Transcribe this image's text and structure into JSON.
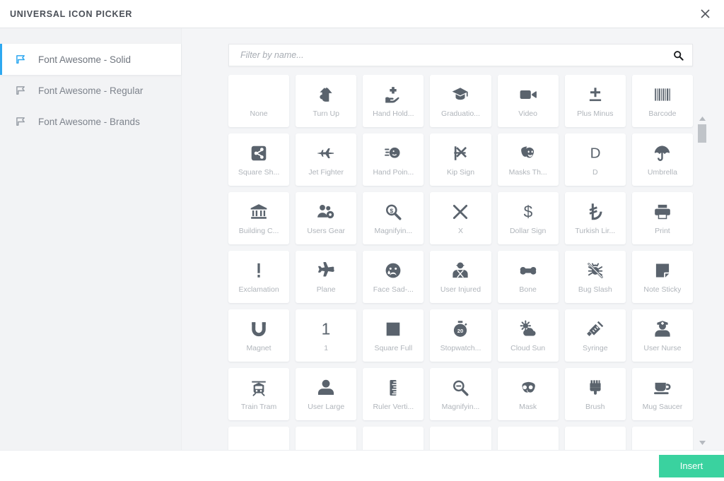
{
  "window": {
    "title": "UNIVERSAL ICON PICKER",
    "close_icon": "close-icon"
  },
  "sidebar": {
    "items": [
      {
        "label": "Font Awesome - Solid",
        "icon": "flag-icon",
        "active": true
      },
      {
        "label": "Font Awesome - Regular",
        "icon": "flag-icon",
        "active": false
      },
      {
        "label": "Font Awesome - Brands",
        "icon": "flag-icon",
        "active": false
      }
    ]
  },
  "search": {
    "placeholder": "Filter by name...",
    "value": "",
    "icon": "search-icon"
  },
  "scrollbar": {
    "up_icon": "caret-up-icon",
    "down_icon": "caret-down-icon",
    "thumb_position_percent": 2
  },
  "footer": {
    "insert_label": "Insert",
    "insert_color": "#3ad29f"
  },
  "colors": {
    "accent": "#2ea8f0",
    "glyph": "#5a636d",
    "label": "#b0b5bb",
    "panel_bg": "#f4f5f7",
    "tile_bg": "#ffffff"
  },
  "grid": {
    "columns": 7,
    "icons": [
      {
        "label": "None",
        "icon": "none-icon",
        "glyph": ""
      },
      {
        "label": "Turn Up",
        "icon": "turn-up-arrow-icon",
        "glyph": "⬑"
      },
      {
        "label": "Hand Hold...",
        "icon": "hand-holding-medical-icon",
        "glyph": "✚"
      },
      {
        "label": "Graduatio...",
        "icon": "graduation-cap-icon",
        "glyph": "🎓"
      },
      {
        "label": "Video",
        "icon": "video-camera-icon",
        "glyph": "▶"
      },
      {
        "label": "Plus Minus",
        "icon": "plus-minus-icon",
        "glyph": "±"
      },
      {
        "label": "Barcode",
        "icon": "barcode-icon",
        "glyph": "|||"
      },
      {
        "label": "Square Sh...",
        "icon": "square-share-nodes-icon",
        "glyph": "⊞"
      },
      {
        "label": "Jet Fighter",
        "icon": "jet-fighter-icon",
        "glyph": "✈"
      },
      {
        "label": "Hand Poin...",
        "icon": "hand-pointer-icon",
        "glyph": "☞"
      },
      {
        "label": "Kip Sign",
        "icon": "kip-sign-icon",
        "glyph": "₭"
      },
      {
        "label": "Masks Th...",
        "icon": "masks-theater-icon",
        "glyph": "🎭"
      },
      {
        "label": "D",
        "icon": "letter-d-icon",
        "glyph": "D"
      },
      {
        "label": "Umbrella",
        "icon": "umbrella-icon",
        "glyph": "☂"
      },
      {
        "label": "Building C...",
        "icon": "building-columns-icon",
        "glyph": "🏛"
      },
      {
        "label": "Users Gear",
        "icon": "users-gear-icon",
        "glyph": "👥"
      },
      {
        "label": "Magnifyin...",
        "icon": "magnifying-glass-dollar-icon",
        "glyph": "🔍"
      },
      {
        "label": "X",
        "icon": "letter-x-icon",
        "glyph": "✕"
      },
      {
        "label": "Dollar Sign",
        "icon": "dollar-sign-icon",
        "glyph": "$"
      },
      {
        "label": "Turkish Lir...",
        "icon": "turkish-lira-sign-icon",
        "glyph": "₺"
      },
      {
        "label": "Print",
        "icon": "print-icon",
        "glyph": "🖨"
      },
      {
        "label": "Exclamation",
        "icon": "exclamation-icon",
        "glyph": "!"
      },
      {
        "label": "Plane",
        "icon": "plane-icon",
        "glyph": "✈"
      },
      {
        "label": "Face Sad-...",
        "icon": "face-sad-tear-icon",
        "glyph": "☹"
      },
      {
        "label": "User Injured",
        "icon": "user-injured-icon",
        "glyph": "🧑"
      },
      {
        "label": "Bone",
        "icon": "bone-icon",
        "glyph": "🦴"
      },
      {
        "label": "Bug Slash",
        "icon": "bug-slash-icon",
        "glyph": "🐞"
      },
      {
        "label": "Note Sticky",
        "icon": "note-sticky-icon",
        "glyph": "▣"
      },
      {
        "label": "Magnet",
        "icon": "magnet-icon",
        "glyph": "U"
      },
      {
        "label": "1",
        "icon": "number-one-icon",
        "glyph": "1"
      },
      {
        "label": "Square Full",
        "icon": "square-full-icon",
        "glyph": "■"
      },
      {
        "label": "Stopwatch...",
        "icon": "stopwatch-20-icon",
        "glyph": "⏱"
      },
      {
        "label": "Cloud Sun",
        "icon": "cloud-sun-icon",
        "glyph": "⛅"
      },
      {
        "label": "Syringe",
        "icon": "syringe-icon",
        "glyph": "💉"
      },
      {
        "label": "User Nurse",
        "icon": "user-nurse-icon",
        "glyph": "👤"
      },
      {
        "label": "Train Tram",
        "icon": "train-tram-icon",
        "glyph": "🚋"
      },
      {
        "label": "User Large",
        "icon": "user-large-icon",
        "glyph": "👤"
      },
      {
        "label": "Ruler Verti...",
        "icon": "ruler-vertical-icon",
        "glyph": "📏"
      },
      {
        "label": "Magnifyin...",
        "icon": "magnifying-glass-minus-icon",
        "glyph": "🔍"
      },
      {
        "label": "Mask",
        "icon": "mask-icon",
        "glyph": "🎭"
      },
      {
        "label": "Brush",
        "icon": "brush-icon",
        "glyph": "🖌"
      },
      {
        "label": "Mug Saucer",
        "icon": "mug-saucer-icon",
        "glyph": "☕"
      },
      {
        "label": "",
        "icon": "partial-row-icon",
        "glyph": ""
      },
      {
        "label": "",
        "icon": "partial-row-icon",
        "glyph": ""
      },
      {
        "label": "",
        "icon": "partial-row-icon",
        "glyph": ""
      },
      {
        "label": "",
        "icon": "partial-row-icon",
        "glyph": ""
      },
      {
        "label": "",
        "icon": "partial-row-icon",
        "glyph": ""
      },
      {
        "label": "",
        "icon": "partial-row-icon",
        "glyph": ""
      },
      {
        "label": "",
        "icon": "partial-row-icon",
        "glyph": ""
      }
    ]
  }
}
